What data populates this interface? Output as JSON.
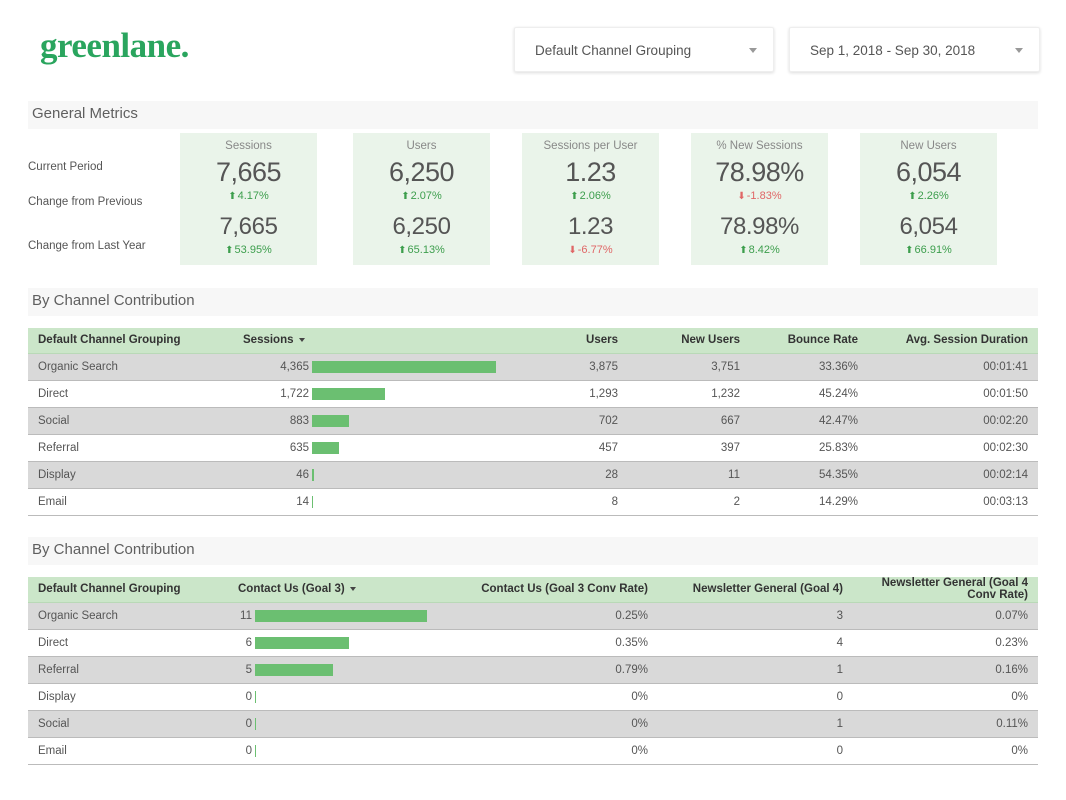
{
  "brand": {
    "text": "greenlane."
  },
  "controls": {
    "grouping": {
      "label": "Default Channel Grouping"
    },
    "daterange": {
      "label": "Sep 1, 2018 - Sep 30, 2018"
    }
  },
  "sections": {
    "general": {
      "title": "General Metrics"
    },
    "channel1": {
      "title": "By Channel Contribution"
    },
    "channel2": {
      "title": "By Channel Contribution"
    }
  },
  "row_labels": {
    "current": "Current Period",
    "prev": "Change from Previous",
    "lastyear": "Change from Last Year"
  },
  "colors": {
    "brand_green": "#2aa55e",
    "card_bg": "#eaf4ea",
    "header_green": "#cbe6c9",
    "bar_green": "#6bbf71",
    "positive": "#3d9e4d",
    "negative": "#e06666",
    "row_odd": "#d9d9d9",
    "band": "#f7f7f7"
  },
  "scorecards": [
    {
      "title": "Sessions",
      "value": "7,665",
      "delta1": "4.17%",
      "delta1_dir": "up",
      "value2": "7,665",
      "delta2": "53.95%",
      "delta2_dir": "up"
    },
    {
      "title": "Users",
      "value": "6,250",
      "delta1": "2.07%",
      "delta1_dir": "up",
      "value2": "6,250",
      "delta2": "65.13%",
      "delta2_dir": "up"
    },
    {
      "title": "Sessions per User",
      "value": "1.23",
      "delta1": "2.06%",
      "delta1_dir": "up",
      "value2": "1.23",
      "delta2": "-6.77%",
      "delta2_dir": "down"
    },
    {
      "title": "% New Sessions",
      "value": "78.98%",
      "delta1": "-1.83%",
      "delta1_dir": "down",
      "value2": "78.98%",
      "delta2": "8.42%",
      "delta2_dir": "up"
    },
    {
      "title": "New Users",
      "value": "6,054",
      "delta1": "2.26%",
      "delta1_dir": "up",
      "value2": "6,054",
      "delta2": "66.91%",
      "delta2_dir": "up"
    }
  ],
  "table1": {
    "columns": [
      "Default Channel Grouping",
      "Sessions",
      "Users",
      "New Users",
      "Bounce Rate",
      "Avg. Session Duration"
    ],
    "sorted_column": 1,
    "rows": [
      {
        "channel": "Organic Search",
        "sessions": "4,365",
        "sessions_num": 4365,
        "users": "3,875",
        "new_users": "3,751",
        "bounce": "33.36%",
        "duration": "00:01:41"
      },
      {
        "channel": "Direct",
        "sessions": "1,722",
        "sessions_num": 1722,
        "users": "1,293",
        "new_users": "1,232",
        "bounce": "45.24%",
        "duration": "00:01:50"
      },
      {
        "channel": "Social",
        "sessions": "883",
        "sessions_num": 883,
        "users": "702",
        "new_users": "667",
        "bounce": "42.47%",
        "duration": "00:02:20"
      },
      {
        "channel": "Referral",
        "sessions": "635",
        "sessions_num": 635,
        "users": "457",
        "new_users": "397",
        "bounce": "25.83%",
        "duration": "00:02:30"
      },
      {
        "channel": "Display",
        "sessions": "46",
        "sessions_num": 46,
        "users": "28",
        "new_users": "11",
        "bounce": "54.35%",
        "duration": "00:02:14"
      },
      {
        "channel": "Email",
        "sessions": "14",
        "sessions_num": 14,
        "users": "8",
        "new_users": "2",
        "bounce": "14.29%",
        "duration": "00:03:13"
      }
    ]
  },
  "table2": {
    "columns": [
      "Default Channel Grouping",
      "Contact Us (Goal 3)",
      "Contact Us (Goal 3 Conv Rate)",
      "Newsletter General (Goal 4)",
      "Newsletter General (Goal 4 Conv Rate)"
    ],
    "sorted_column": 1,
    "rows": [
      {
        "channel": "Organic Search",
        "goal3": "11",
        "goal3_num": 11,
        "goal3_rate": "0.25%",
        "goal4": "3",
        "goal4_rate": "0.07%"
      },
      {
        "channel": "Direct",
        "goal3": "6",
        "goal3_num": 6,
        "goal3_rate": "0.35%",
        "goal4": "4",
        "goal4_rate": "0.23%"
      },
      {
        "channel": "Referral",
        "goal3": "5",
        "goal3_num": 5,
        "goal3_rate": "0.79%",
        "goal4": "1",
        "goal4_rate": "0.16%"
      },
      {
        "channel": "Display",
        "goal3": "0",
        "goal3_num": 0,
        "goal3_rate": "0%",
        "goal4": "0",
        "goal4_rate": "0%"
      },
      {
        "channel": "Social",
        "goal3": "0",
        "goal3_num": 0,
        "goal3_rate": "0%",
        "goal4": "1",
        "goal4_rate": "0.11%"
      },
      {
        "channel": "Email",
        "goal3": "0",
        "goal3_num": 0,
        "goal3_rate": "0%",
        "goal4": "0",
        "goal4_rate": "0%"
      }
    ]
  }
}
